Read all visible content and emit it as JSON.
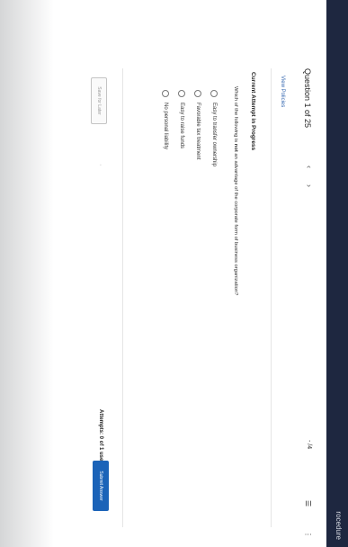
{
  "header": {
    "truncated_text": "rocedure"
  },
  "question": {
    "title": "Question 1 of 25",
    "prev_icon": "chevron-left-icon",
    "next_icon": "chevron-right-icon",
    "points": "- /4",
    "grid_icon": "grid-icon",
    "menu_icon": "kebab-icon",
    "view_policies": "View Policies",
    "attempt_header": "Current Attempt in Progress",
    "prompt_before": "Which of the following is ",
    "prompt_emphasis": "not",
    "prompt_after": " an advantage of the corporate form of business organization?",
    "options": [
      "Easy to transfer ownership",
      "Favorable tax treatment",
      "Easy to raise funds",
      "No personal liability"
    ]
  },
  "footer": {
    "save_later": "Save for Later",
    "attempts": "Attempts: 0 of 1 used",
    "submit": "Submit Answer"
  },
  "colors": {
    "header_bg": "#1e2740",
    "link": "#3467b0",
    "submit_bg": "#1b63b8"
  }
}
